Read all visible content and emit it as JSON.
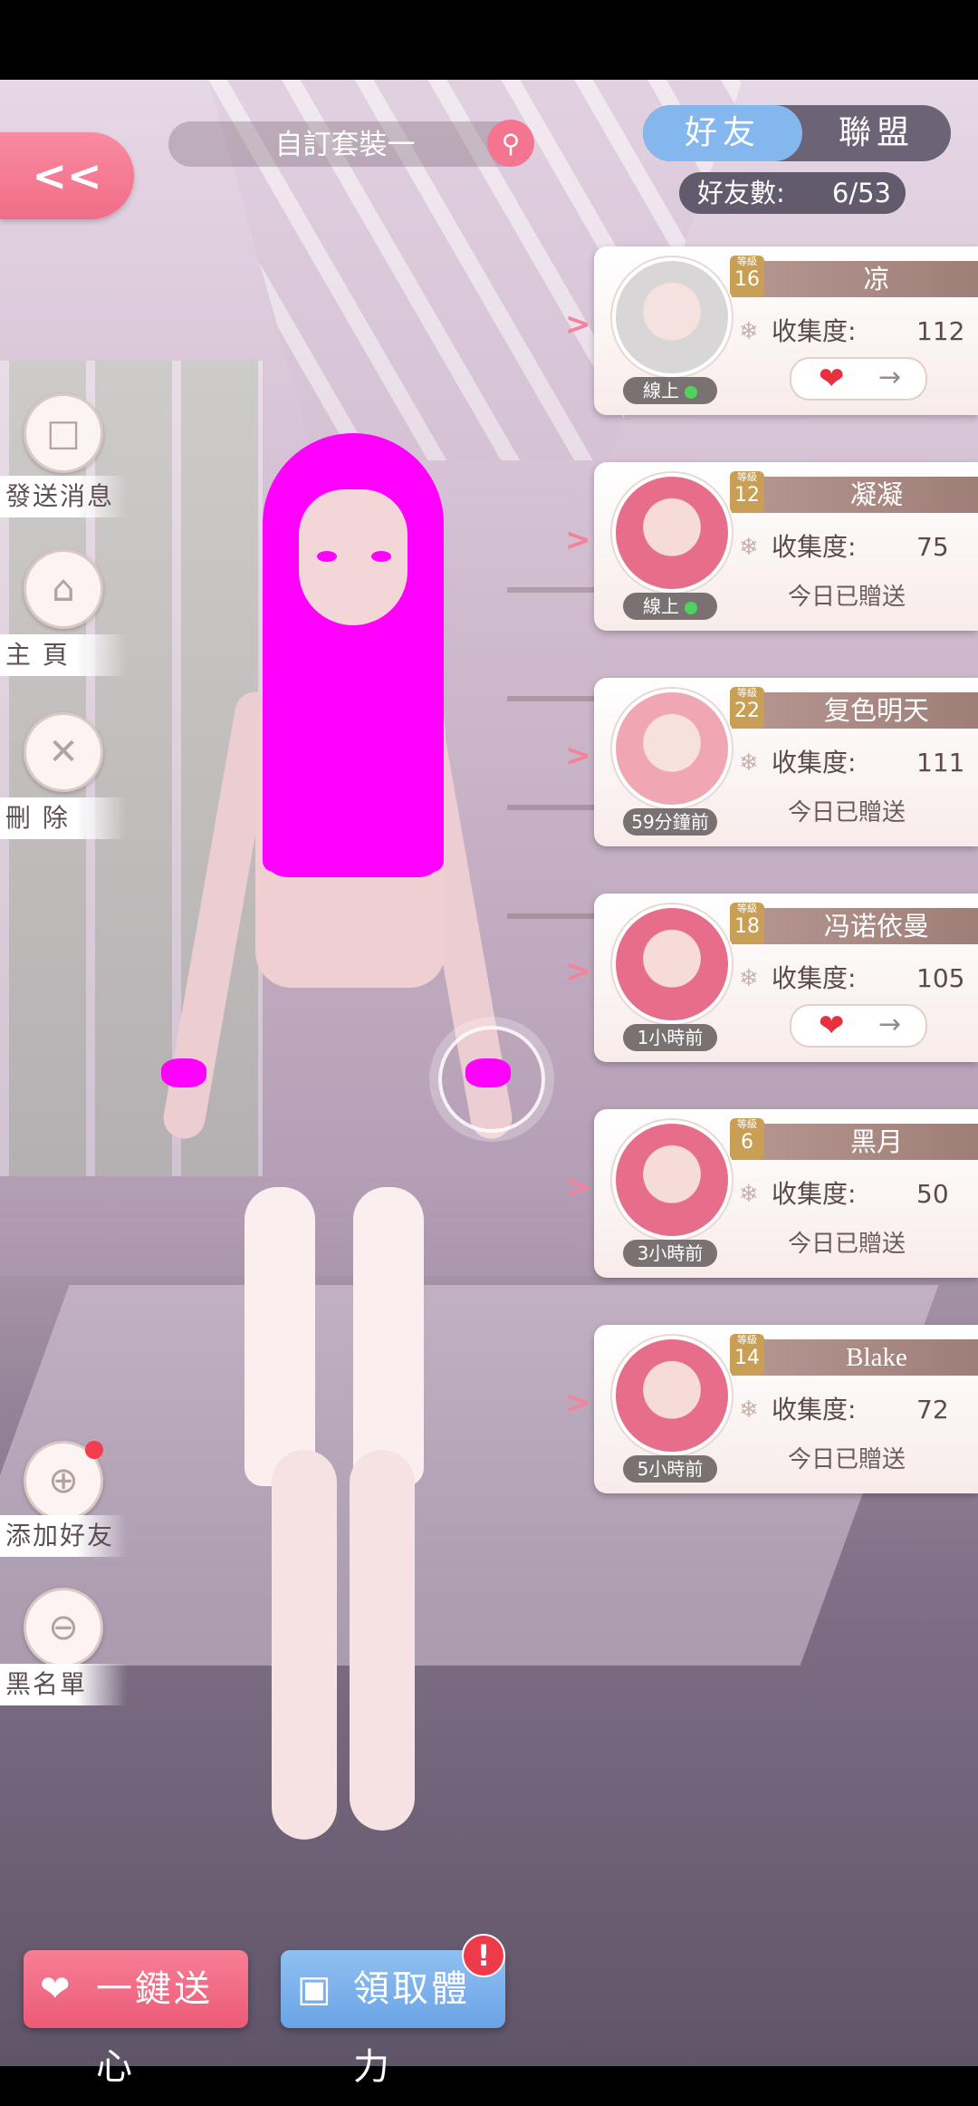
{
  "header": {
    "back_label": "<<",
    "outfit_name": "自訂套裝一",
    "tabs": [
      {
        "label": "好友",
        "active": true
      },
      {
        "label": "聯盟",
        "active": false
      }
    ],
    "friend_count_label": "好友數:",
    "friend_count_value": "6/53"
  },
  "side_menu": {
    "items": [
      {
        "label": "發送消息",
        "icon": "chat-icon"
      },
      {
        "label": "主 頁",
        "icon": "home-icon"
      },
      {
        "label": "刪 除",
        "icon": "delete-icon"
      },
      {
        "label": "添加好友",
        "icon": "add-friend-icon"
      },
      {
        "label": "黑名單",
        "icon": "blacklist-icon"
      }
    ]
  },
  "level_caption": "等級",
  "collect_label": "收集度:",
  "sent_today_label": "今日已贈送",
  "friends": [
    {
      "name": "凉",
      "level": "16",
      "collection": "112",
      "status": "線上",
      "online": true,
      "gift_state": "send"
    },
    {
      "name": "凝凝",
      "level": "12",
      "collection": "75",
      "status": "線上",
      "online": true,
      "gift_state": "sent"
    },
    {
      "name": "复色明天",
      "level": "22",
      "collection": "111",
      "status": "59分鐘前",
      "online": false,
      "gift_state": "sent"
    },
    {
      "name": "冯诺依曼",
      "level": "18",
      "collection": "105",
      "status": "1小時前",
      "online": false,
      "gift_state": "send"
    },
    {
      "name": "黑月",
      "level": "6",
      "collection": "50",
      "status": "3小時前",
      "online": false,
      "gift_state": "sent"
    },
    {
      "name": "Blake",
      "level": "14",
      "collection": "72",
      "status": "5小時前",
      "online": false,
      "gift_state": "sent"
    }
  ],
  "bottom": {
    "send_all_label": "一鍵送心",
    "claim_label": "領取體力",
    "claim_alert": "!"
  },
  "colors": {
    "accent_pink": "#f06d88",
    "accent_blue": "#84b7ee",
    "online_green": "#4fd35c",
    "level_gold": "#c99f55"
  }
}
